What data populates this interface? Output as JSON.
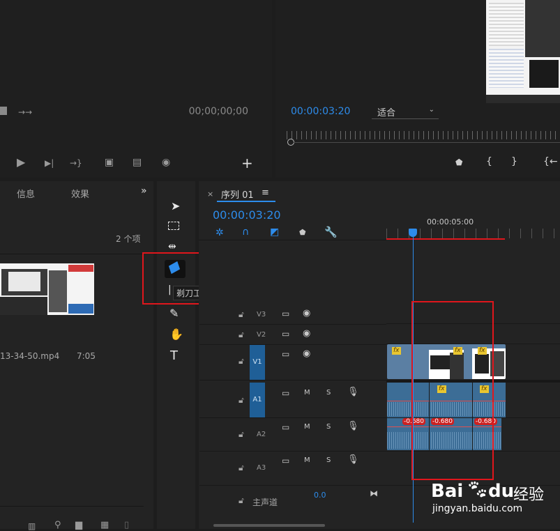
{
  "source_monitor": {
    "timecode": "00;00;00;00"
  },
  "program_monitor": {
    "timecode": "00:00:03:20",
    "fit_label": "适合"
  },
  "project_panel": {
    "tabs": [
      "信息",
      "效果"
    ],
    "item_count": "2 个项",
    "clip_name": "13-34-50.mp4",
    "clip_duration": "7:05"
  },
  "tools": {
    "tooltip": "剃刀工具 (C)"
  },
  "timeline": {
    "close_glyph": "×",
    "sequence_name": "序列 01",
    "menu_glyph": "≡",
    "timecode": "00:00:03:20",
    "ruler_label": "00:00:05:00",
    "tracks": {
      "v3": "V3",
      "v2": "V2",
      "v1_sel": "V1",
      "v1": "V1",
      "a1_sel": "A1",
      "a1": "A1",
      "a2": "A2",
      "a3": "A3"
    },
    "mute_label": "M",
    "solo_label": "S",
    "master_label": "主声道",
    "master_value": "0.0",
    "fx_label": "fx",
    "audio_fx_values": [
      "-0.680",
      "-0.680",
      "-0.680"
    ]
  },
  "watermark": {
    "brand": "Bai",
    "brand2": "du",
    "brand_cn": "经验",
    "url": "jingyan.baidu.com"
  },
  "colors": {
    "accent_blue": "#2d8ceb",
    "annotation_red": "#e0161c",
    "clip_video": "#5b7fa3",
    "clip_audio": "#3c6d96",
    "fx_badge": "#e9c630"
  }
}
